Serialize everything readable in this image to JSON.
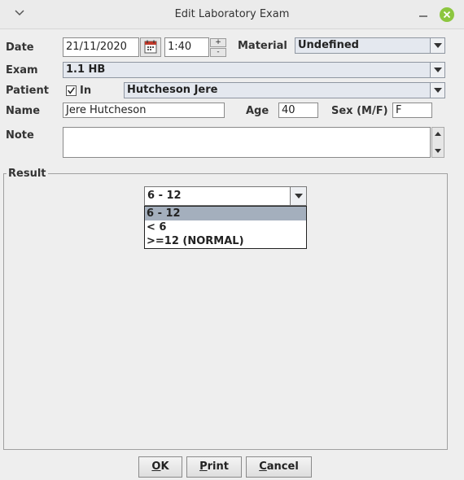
{
  "window": {
    "title": "Edit Laboratory Exam"
  },
  "form": {
    "date_label": "Date",
    "date_value": "21/11/2020",
    "time_value": "1:40",
    "spin_up": "+",
    "spin_down": "-",
    "material_label": "Material",
    "material_value": "Undefined",
    "exam_label": "Exam",
    "exam_value": "1.1 HB",
    "patient_label": "Patient",
    "in_label": "In",
    "in_checked": true,
    "patient_value": "Hutcheson Jere",
    "name_label": "Name",
    "name_value": "Jere Hutcheson",
    "age_label": "Age",
    "age_value": "40",
    "sex_label": "Sex (M/F)",
    "sex_value": "F",
    "note_label": "Note",
    "note_value": ""
  },
  "result": {
    "legend": "Result",
    "selected": "6 - 12",
    "options": [
      "6 - 12",
      "< 6",
      ">=12 (NORMAL)"
    ]
  },
  "buttons": {
    "ok": {
      "key": "O",
      "rest": "K"
    },
    "print": {
      "key": "P",
      "rest": "rint"
    },
    "cancel": {
      "key": "C",
      "rest": "ancel"
    }
  },
  "colors": {
    "close_button": "#8cc63f",
    "selected_option": "#a4afbd"
  }
}
